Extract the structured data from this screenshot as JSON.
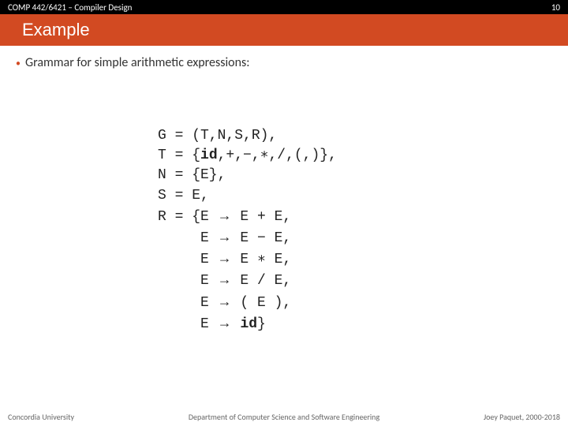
{
  "header": {
    "course": "COMP 442/6421 – Compiler Design",
    "slide_no": "10"
  },
  "title": "Example",
  "bullet": "Grammar for simple arithmetic expressions:",
  "grammar": {
    "l1_a": "G = (T,N,S,R),",
    "l2_a": "T = {",
    "l2_b": "id",
    "l2_c": ",+,−,∗,/,(,)},",
    "l3_a": "N = {E},",
    "l4_a": "S = E,",
    "l5_a": "R = {E ",
    "l5_arr": "→",
    "l5_b": " E + E,",
    "l6_a": "     E ",
    "l6_arr": "→",
    "l6_b": " E − E,",
    "l7_a": "     E ",
    "l7_arr": "→",
    "l7_b": " E ∗ E,",
    "l8_a": "     E ",
    "l8_arr": "→",
    "l8_b": " E / E,",
    "l9_a": "     E ",
    "l9_arr": "→",
    "l9_b": " ( E ),",
    "l10_a": "     E ",
    "l10_arr": "→",
    "l10_b": " ",
    "l10_c": "id",
    "l10_d": "}"
  },
  "footer": {
    "left": "Concordia University",
    "center": "Department of Computer Science and Software Engineering",
    "right": "Joey Paquet, 2000-2018"
  }
}
